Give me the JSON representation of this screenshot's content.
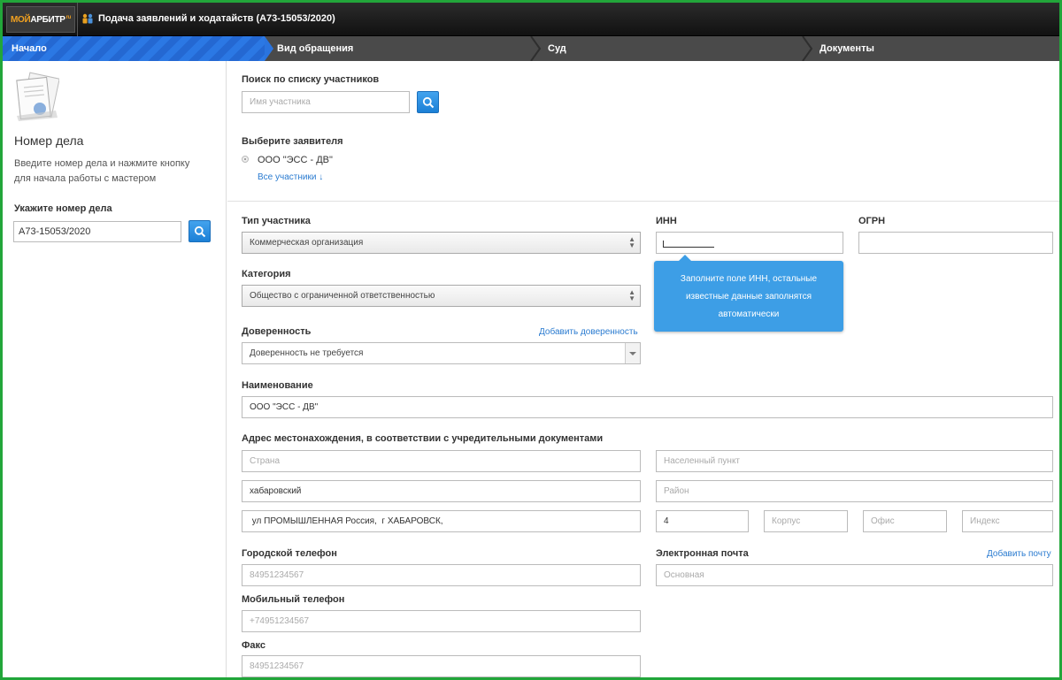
{
  "header": {
    "logo_moi": "МОЙ",
    "logo_arbitr": "АРБИТР",
    "logo_ru": "ru",
    "title": "Подача заявлений и ходатайств  (А73-15053/2020)"
  },
  "steps": [
    {
      "label": "Начало"
    },
    {
      "label": "Вид обращения"
    },
    {
      "label": "Суд"
    },
    {
      "label": "Документы"
    }
  ],
  "sidebar": {
    "title": "Номер дела",
    "description": "Введите номер дела и нажмите кнопку для начала работы с мастером",
    "case_label": "Укажите номер дела",
    "case_value": "А73-15053/2020"
  },
  "participants": {
    "search_label": "Поиск по списку участников",
    "search_placeholder": "Имя участника",
    "choose_label": "Выберите заявителя",
    "applicant": "ООО \"ЭСС - ДВ\"",
    "all_link": "Все участники ↓"
  },
  "form": {
    "type_label": "Тип участника",
    "type_value": "Коммерческая организация",
    "inn_label": "ИНН",
    "ogrn_label": "ОГРН",
    "category_label": "Категория",
    "category_value": "Общество с ограниченной ответственностью",
    "proxy_label": "Доверенность",
    "proxy_link": "Добавить доверенность",
    "proxy_value": "Доверенность не требуется",
    "name_label": "Наименование",
    "name_value": "ООО \"ЭСС - ДВ\"",
    "address_label": "Адрес местонахождения, в соответствии с учредительными документами",
    "country_placeholder": "Страна",
    "locality_placeholder": "Населенный пункт",
    "region_value": "хабаровский",
    "district_placeholder": "Район",
    "street_value": " ул ПРОМЫШЛЕННАЯ Россия,  г ХАБАРОВСК,",
    "house_value": "4",
    "building_placeholder": "Корпус",
    "office_placeholder": "Офис",
    "index_placeholder": "Индекс",
    "phone_label": "Городской телефон",
    "phone_placeholder": "84951234567",
    "email_label": "Электронная почта",
    "email_link": "Добавить почту",
    "email_placeholder": "Основная",
    "mobile_label": "Мобильный телефон",
    "mobile_placeholder": "+74951234567",
    "fax_label": "Факс",
    "fax_placeholder": "84951234567"
  },
  "tooltip": {
    "text": "Заполните поле ИНН, остальные известные данные заполнятся автоматически"
  },
  "colors": {
    "accent": "#2b78e4",
    "frame": "#22a63a",
    "tooltip": "#3d9ee6",
    "link": "#2a7bd0"
  }
}
